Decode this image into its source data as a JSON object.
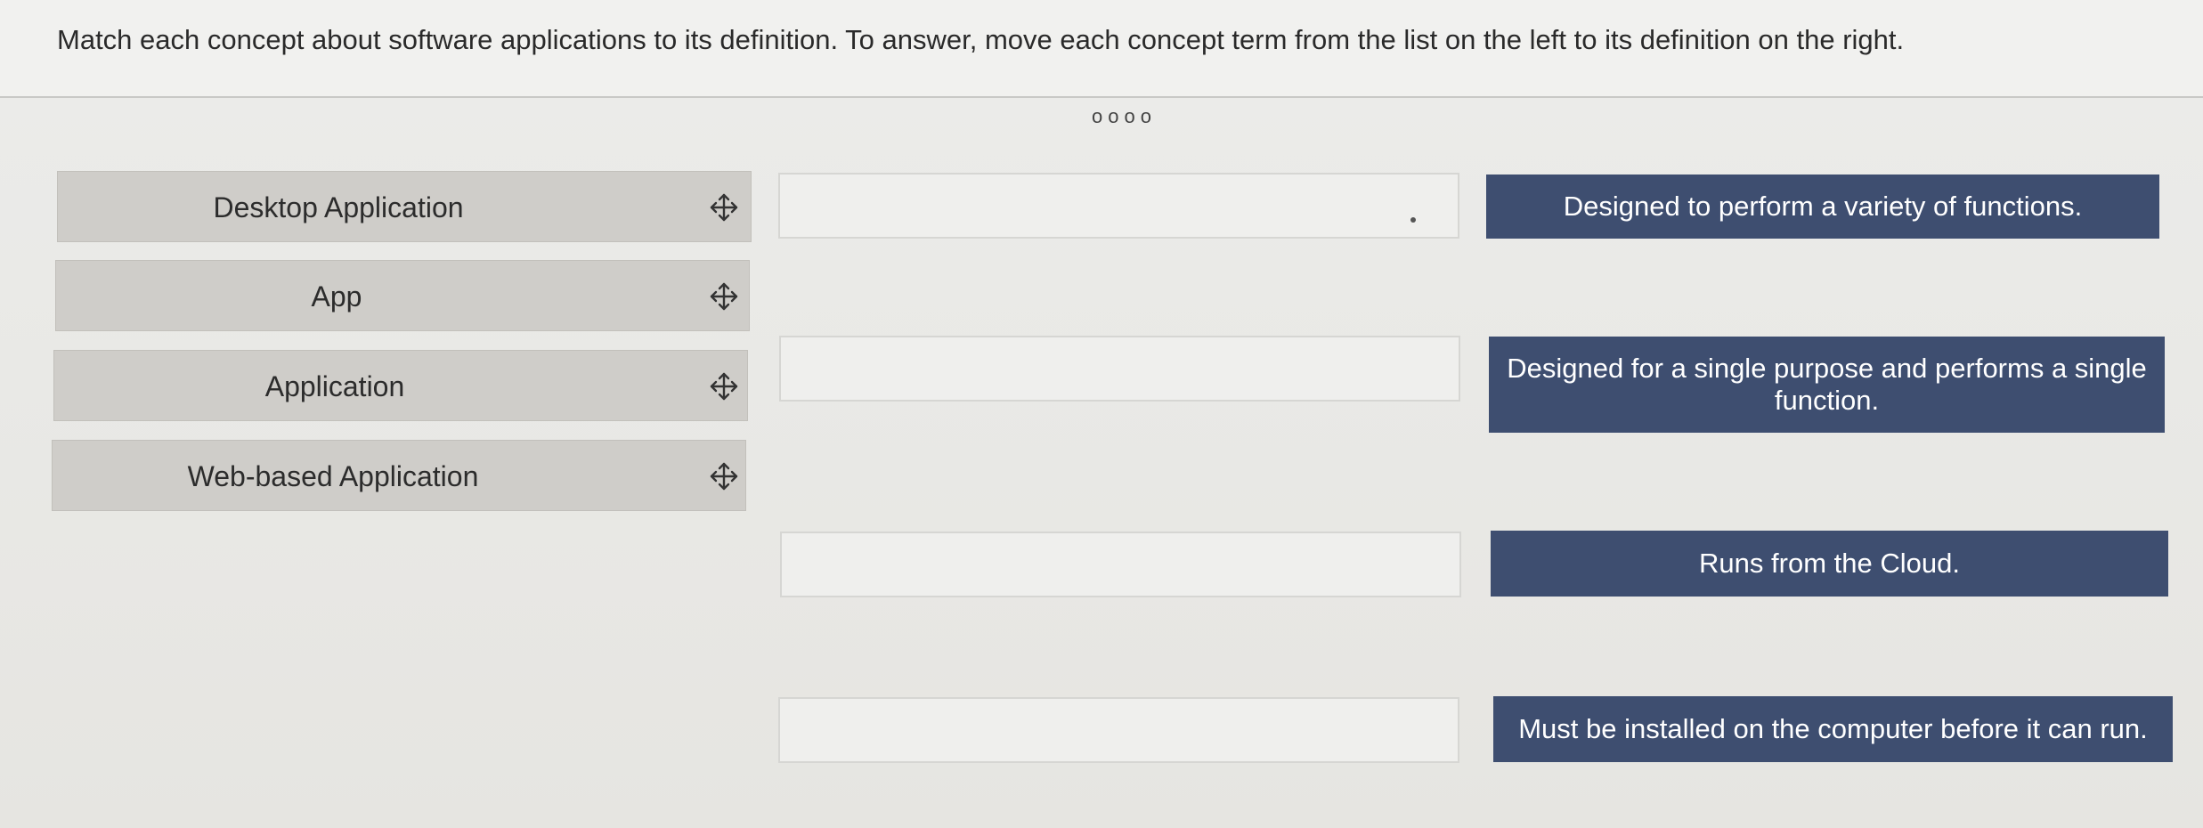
{
  "instructions": {
    "text": "Match each concept about software applications to its definition. To answer, move each concept term from the list on the left to its definition on the right."
  },
  "pager": {
    "text": "oooo"
  },
  "terms": [
    {
      "label": "Desktop Application",
      "icon": "move-icon"
    },
    {
      "label": "App",
      "icon": "move-icon"
    },
    {
      "label": "Application",
      "icon": "move-icon"
    },
    {
      "label": "Web-based Application",
      "icon": "move-icon"
    }
  ],
  "definitions": [
    {
      "text": "Designed to perform a variety of functions."
    },
    {
      "text": "Designed for a single purpose and performs a single function."
    },
    {
      "text": "Runs from the Cloud."
    },
    {
      "text": "Must be installed on the computer before it can run."
    }
  ],
  "colors": {
    "definition_bg": "#3e4e70",
    "term_bg": "#cfcdc9",
    "slot_bg": "#efefed"
  }
}
